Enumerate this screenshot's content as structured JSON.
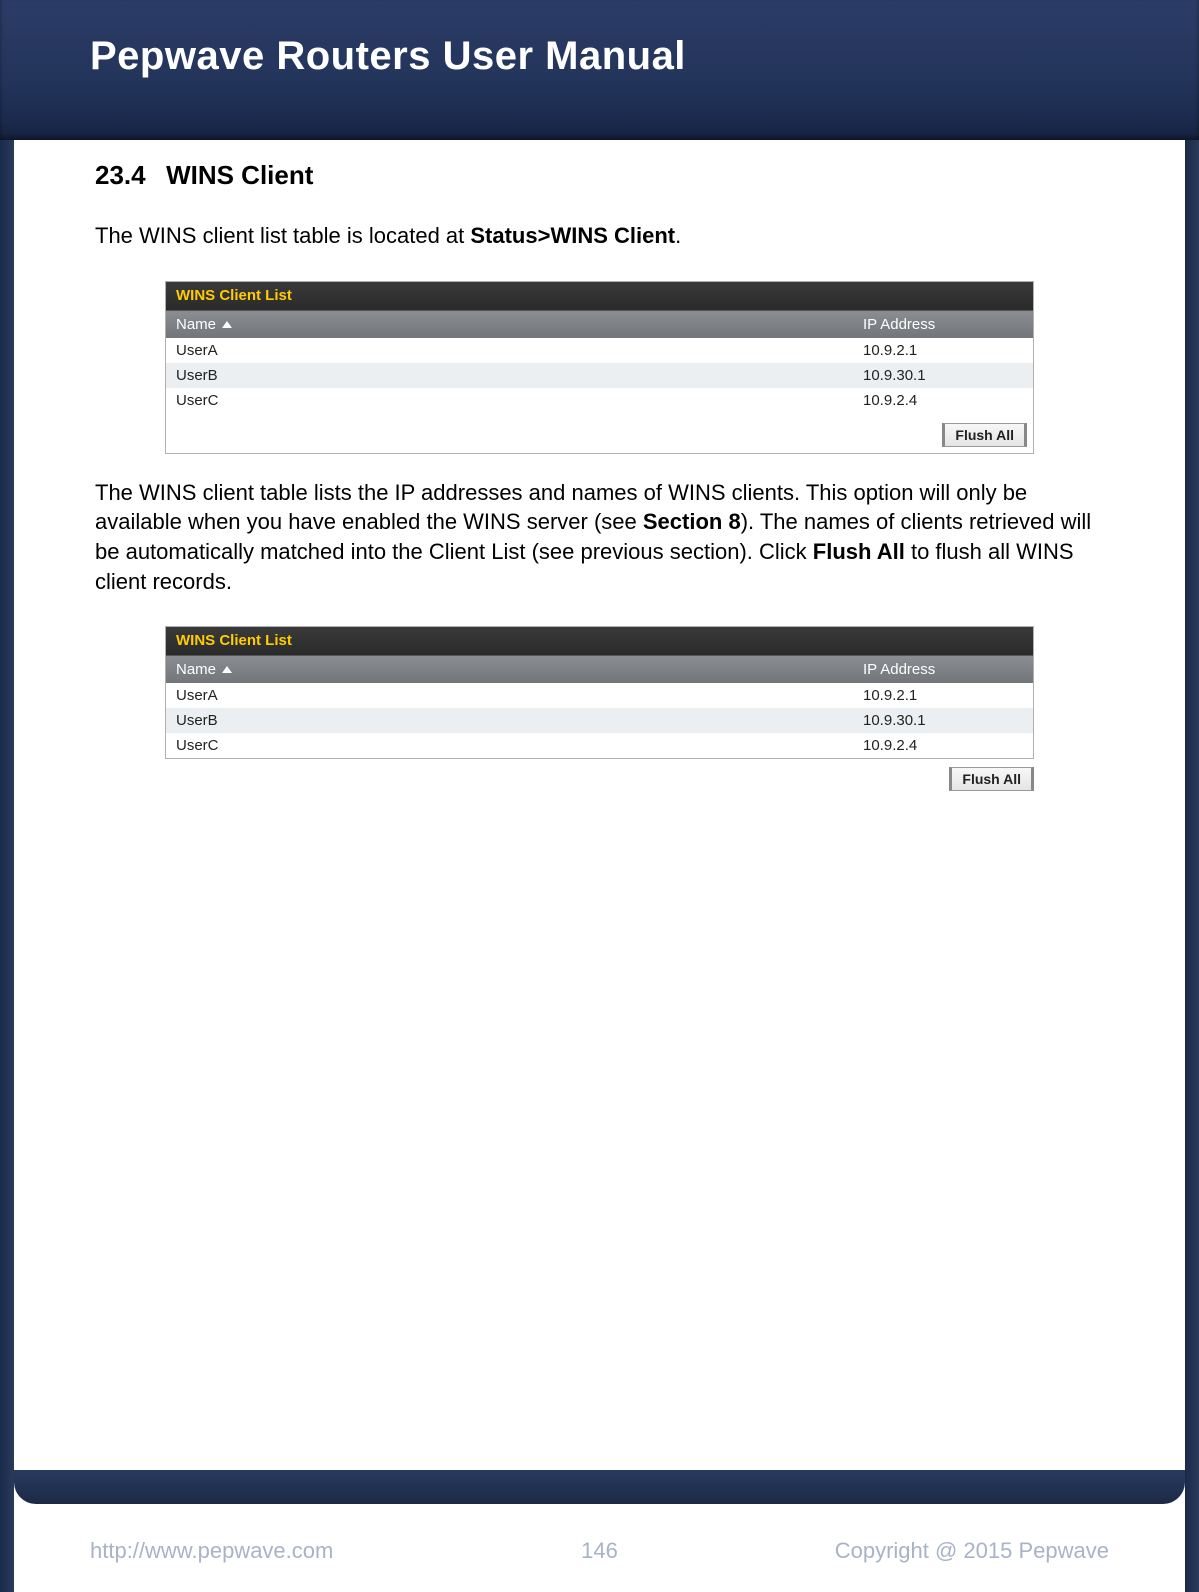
{
  "header": {
    "title": "Pepwave Routers User Manual"
  },
  "section": {
    "number": "23.4",
    "title": "WINS Client"
  },
  "intro": {
    "text_before": "The WINS client list table is located at ",
    "bold": "Status>WINS Client",
    "text_after": "."
  },
  "table1": {
    "title": "WINS Client List",
    "col_name": "Name",
    "col_ip": "IP Address",
    "rows": [
      {
        "name": "UserA",
        "ip": "10.9.2.1"
      },
      {
        "name": "UserB",
        "ip": "10.9.30.1"
      },
      {
        "name": "UserC",
        "ip": "10.9.2.4"
      }
    ],
    "flush_label": "Flush All"
  },
  "para2": {
    "t1": "The WINS client table lists the IP addresses and names of WINS clients. This option will only be available when you have enabled the WINS server (see ",
    "b1": "Section 8",
    "t2": "). The names of clients retrieved will be automatically matched into the Client List (see previous section). Click ",
    "b2": "Flush All",
    "t3": " to flush all WINS client records."
  },
  "table2": {
    "title": "WINS Client List",
    "col_name": "Name",
    "col_ip": "IP Address",
    "rows": [
      {
        "name": "UserA",
        "ip": "10.9.2.1"
      },
      {
        "name": "UserB",
        "ip": "10.9.30.1"
      },
      {
        "name": "UserC",
        "ip": "10.9.2.4"
      }
    ],
    "flush_label": "Flush All"
  },
  "footer": {
    "url": "http://www.pepwave.com",
    "page": "146",
    "copyright": "Copyright @ 2015 Pepwave"
  }
}
